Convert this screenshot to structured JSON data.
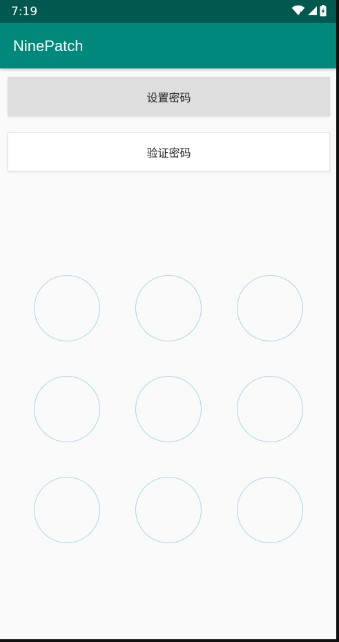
{
  "status_bar": {
    "time": "7:19",
    "icons": [
      "wifi-icon",
      "signal-icon",
      "battery-icon"
    ]
  },
  "app_bar": {
    "title": "NinePatch"
  },
  "buttons": {
    "set_password": "设置密码",
    "verify_password": "验证密码"
  },
  "pattern": {
    "rows": 3,
    "cols": 3,
    "dot_color": "#a6d6ea"
  },
  "colors": {
    "status_bar": "#00584e",
    "app_bar": "#00897b",
    "background": "#fafafa"
  }
}
